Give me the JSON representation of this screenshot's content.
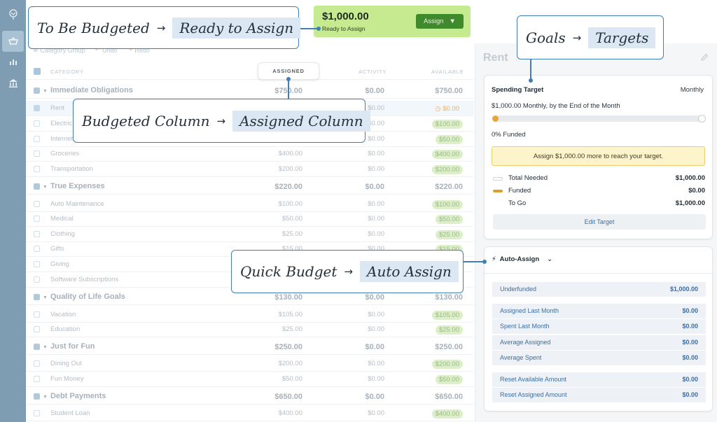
{
  "rail": {
    "icons": [
      "tree-logo-icon",
      "budget-icon",
      "reports-icon",
      "accounts-icon"
    ]
  },
  "toolbar": {
    "category_group": "Category Group",
    "undo": "Undo",
    "redo": "Redo"
  },
  "table": {
    "headers": {
      "category": "CATEGORY",
      "assigned": "ASSIGNED",
      "activity": "ACTIVITY",
      "available": "AVAILABLE"
    },
    "rows": [
      {
        "type": "group",
        "name": "Immediate Obligations",
        "assigned": "$750.00",
        "activity": "$0.00",
        "available": "$750.00"
      },
      {
        "type": "item",
        "name": "Rent",
        "assigned": "",
        "activity": "$0.00",
        "available": "$0.00",
        "selected": true,
        "warn": true
      },
      {
        "type": "item",
        "name": "Electric",
        "assigned": "",
        "activity": "$0.00",
        "available": "$100.00"
      },
      {
        "type": "item",
        "name": "Internet",
        "assigned": "",
        "activity": "$0.00",
        "available": "$50.00"
      },
      {
        "type": "item",
        "name": "Groceries",
        "assigned": "$400.00",
        "activity": "$0.00",
        "available": "$400.00"
      },
      {
        "type": "item",
        "name": "Transportation",
        "assigned": "$200.00",
        "activity": "$0.00",
        "available": "$200.00"
      },
      {
        "type": "group",
        "name": "True Expenses",
        "assigned": "$220.00",
        "activity": "$0.00",
        "available": "$220.00"
      },
      {
        "type": "item",
        "name": "Auto Maintenance",
        "assigned": "$100.00",
        "activity": "$0.00",
        "available": "$100.00"
      },
      {
        "type": "item",
        "name": "Medical",
        "assigned": "$50.00",
        "activity": "$0.00",
        "available": "$50.00"
      },
      {
        "type": "item",
        "name": "Clothing",
        "assigned": "$25.00",
        "activity": "$0.00",
        "available": "$25.00"
      },
      {
        "type": "item",
        "name": "Gifts",
        "assigned": "$15.00",
        "activity": "$0.00",
        "available": "$15.00"
      },
      {
        "type": "item",
        "name": "Giving",
        "assigned": "",
        "activity": "",
        "available": ""
      },
      {
        "type": "item",
        "name": "Software Subscriptions",
        "assigned": "",
        "activity": "",
        "available": ""
      },
      {
        "type": "group",
        "name": "Quality of Life Goals",
        "assigned": "$130.00",
        "activity": "$0.00",
        "available": "$130.00"
      },
      {
        "type": "item",
        "name": "Vacation",
        "assigned": "$105.00",
        "activity": "$0.00",
        "available": "$105.00"
      },
      {
        "type": "item",
        "name": "Education",
        "assigned": "$25.00",
        "activity": "$0.00",
        "available": "$25.00"
      },
      {
        "type": "group",
        "name": "Just for Fun",
        "assigned": "$250.00",
        "activity": "$0.00",
        "available": "$250.00"
      },
      {
        "type": "item",
        "name": "Dining Out",
        "assigned": "$200.00",
        "activity": "$0.00",
        "available": "$200.00"
      },
      {
        "type": "item",
        "name": "Fun Money",
        "assigned": "$50.00",
        "activity": "$0.00",
        "available": "$50.00"
      },
      {
        "type": "group",
        "name": "Debt Payments",
        "assigned": "$650.00",
        "activity": "$0.00",
        "available": "$650.00"
      },
      {
        "type": "item",
        "name": "Student Loan",
        "assigned": "$400.00",
        "activity": "$0.00",
        "available": "$400.00"
      }
    ]
  },
  "ready_to_assign": {
    "amount": "$1,000.00",
    "label": "Ready to Assign",
    "button": "Assign"
  },
  "inspector": {
    "title": "Rent",
    "target": {
      "title": "Spending Target",
      "frequency": "Monthly",
      "description": "$1,000.00 Monthly, by the End of the Month",
      "funded_fraction": 0,
      "funded_text": "0% Funded",
      "message": "Assign $1,000.00 more to reach your target.",
      "rows": [
        {
          "label": "Total Needed",
          "value": "$1,000.00"
        },
        {
          "label": "Funded",
          "value": "$0.00"
        },
        {
          "label": "To Go",
          "value": "$1,000.00"
        }
      ],
      "edit_button": "Edit Target"
    },
    "auto_assign": {
      "title": "Auto-Assign",
      "rows": [
        {
          "label": "Underfunded",
          "value": "$1,000.00"
        },
        {
          "label": "Assigned Last Month",
          "value": "$0.00"
        },
        {
          "label": "Spent Last Month",
          "value": "$0.00"
        },
        {
          "label": "Average Assigned",
          "value": "$0.00"
        },
        {
          "label": "Average Spent",
          "value": "$0.00"
        },
        {
          "label": "Reset Available Amount",
          "value": "$0.00"
        },
        {
          "label": "Reset Assigned Amount",
          "value": "$0.00"
        }
      ]
    }
  },
  "callouts": [
    {
      "old": "To Be Budgeted",
      "new": "Ready to Assign"
    },
    {
      "old": "Goals",
      "new": "Targets"
    },
    {
      "old": "Budgeted Column",
      "new": "Assigned Column"
    },
    {
      "old": "Quick Budget",
      "new": "Auto Assign"
    }
  ],
  "colors": {
    "rail": "#7e9db3",
    "rta_bg": "#c6ea8f",
    "assign_btn": "#3f8a2a",
    "callout_border": "#3e7fb8",
    "callout_highlight": "#dbe7f2",
    "link": "#3a6ea5",
    "funded_bar": "#e7a53a"
  }
}
